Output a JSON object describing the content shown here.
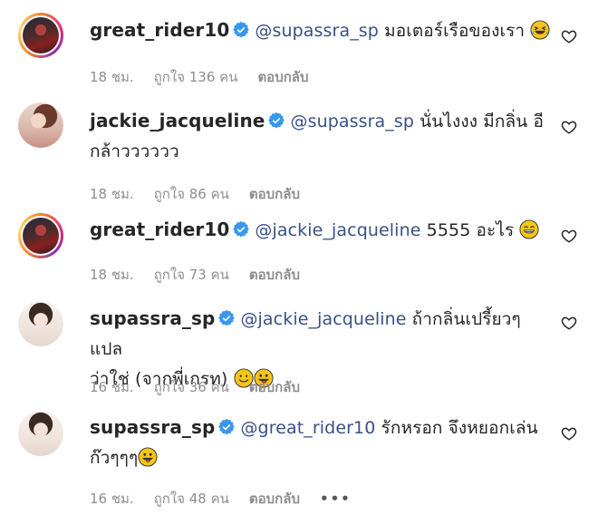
{
  "comments": [
    {
      "username": "great_rider10",
      "mention": "@supassra_sp",
      "text": " มอเตอร์เรือของเรา",
      "time": "18 ชม.",
      "likes": "ถูกใจ 136 คน",
      "reply": "ตอบกลับ",
      "emoji": "rolling-laughing-emoji"
    },
    {
      "username": "jackie_jacqueline",
      "mention": "@supassra_sp",
      "text_line1": " นั่นไงงง มีกลิ่น อี",
      "text_line2": "กล้าวววววว",
      "time": "18 ชม.",
      "likes": "ถูกใจ 86 คน",
      "reply": "ตอบกลับ"
    },
    {
      "username": "great_rider10",
      "mention": "@jackie_jacqueline",
      "text": " 5555 อะไร",
      "time": "18 ชม.",
      "likes": "ถูกใจ 73 คน",
      "reply": "ตอบกลับ",
      "emoji": "grinning-emoji"
    },
    {
      "username": "supassra_sp",
      "mention": "@jackie_jacqueline",
      "text_line1": " ถ้ากลิ่นเปรี้ยวๆแปล",
      "text_line2": "ว่าใช่ (จากพี่เกรท)",
      "time": "16 ชม.",
      "likes": "ถูกใจ 36 คน",
      "reply": "ตอบกลับ",
      "emoji": [
        "smiling-emoji",
        "tongue-wink-emoji"
      ]
    },
    {
      "username": "supassra_sp",
      "mention": "@great_rider10",
      "text_line1": " รักหรอก จึงหยอกเล่น",
      "text_line2": "ก๊วๆๆๆ",
      "time": "16 ชม.",
      "likes": "ถูกใจ 48 คน",
      "reply": "ตอบกลับ",
      "more": "•••",
      "emoji": "tongue-wink-emoji"
    }
  ],
  "colors": {
    "mention": "#385185",
    "meta": "#8e8e8e",
    "verified": "#3897f0"
  }
}
